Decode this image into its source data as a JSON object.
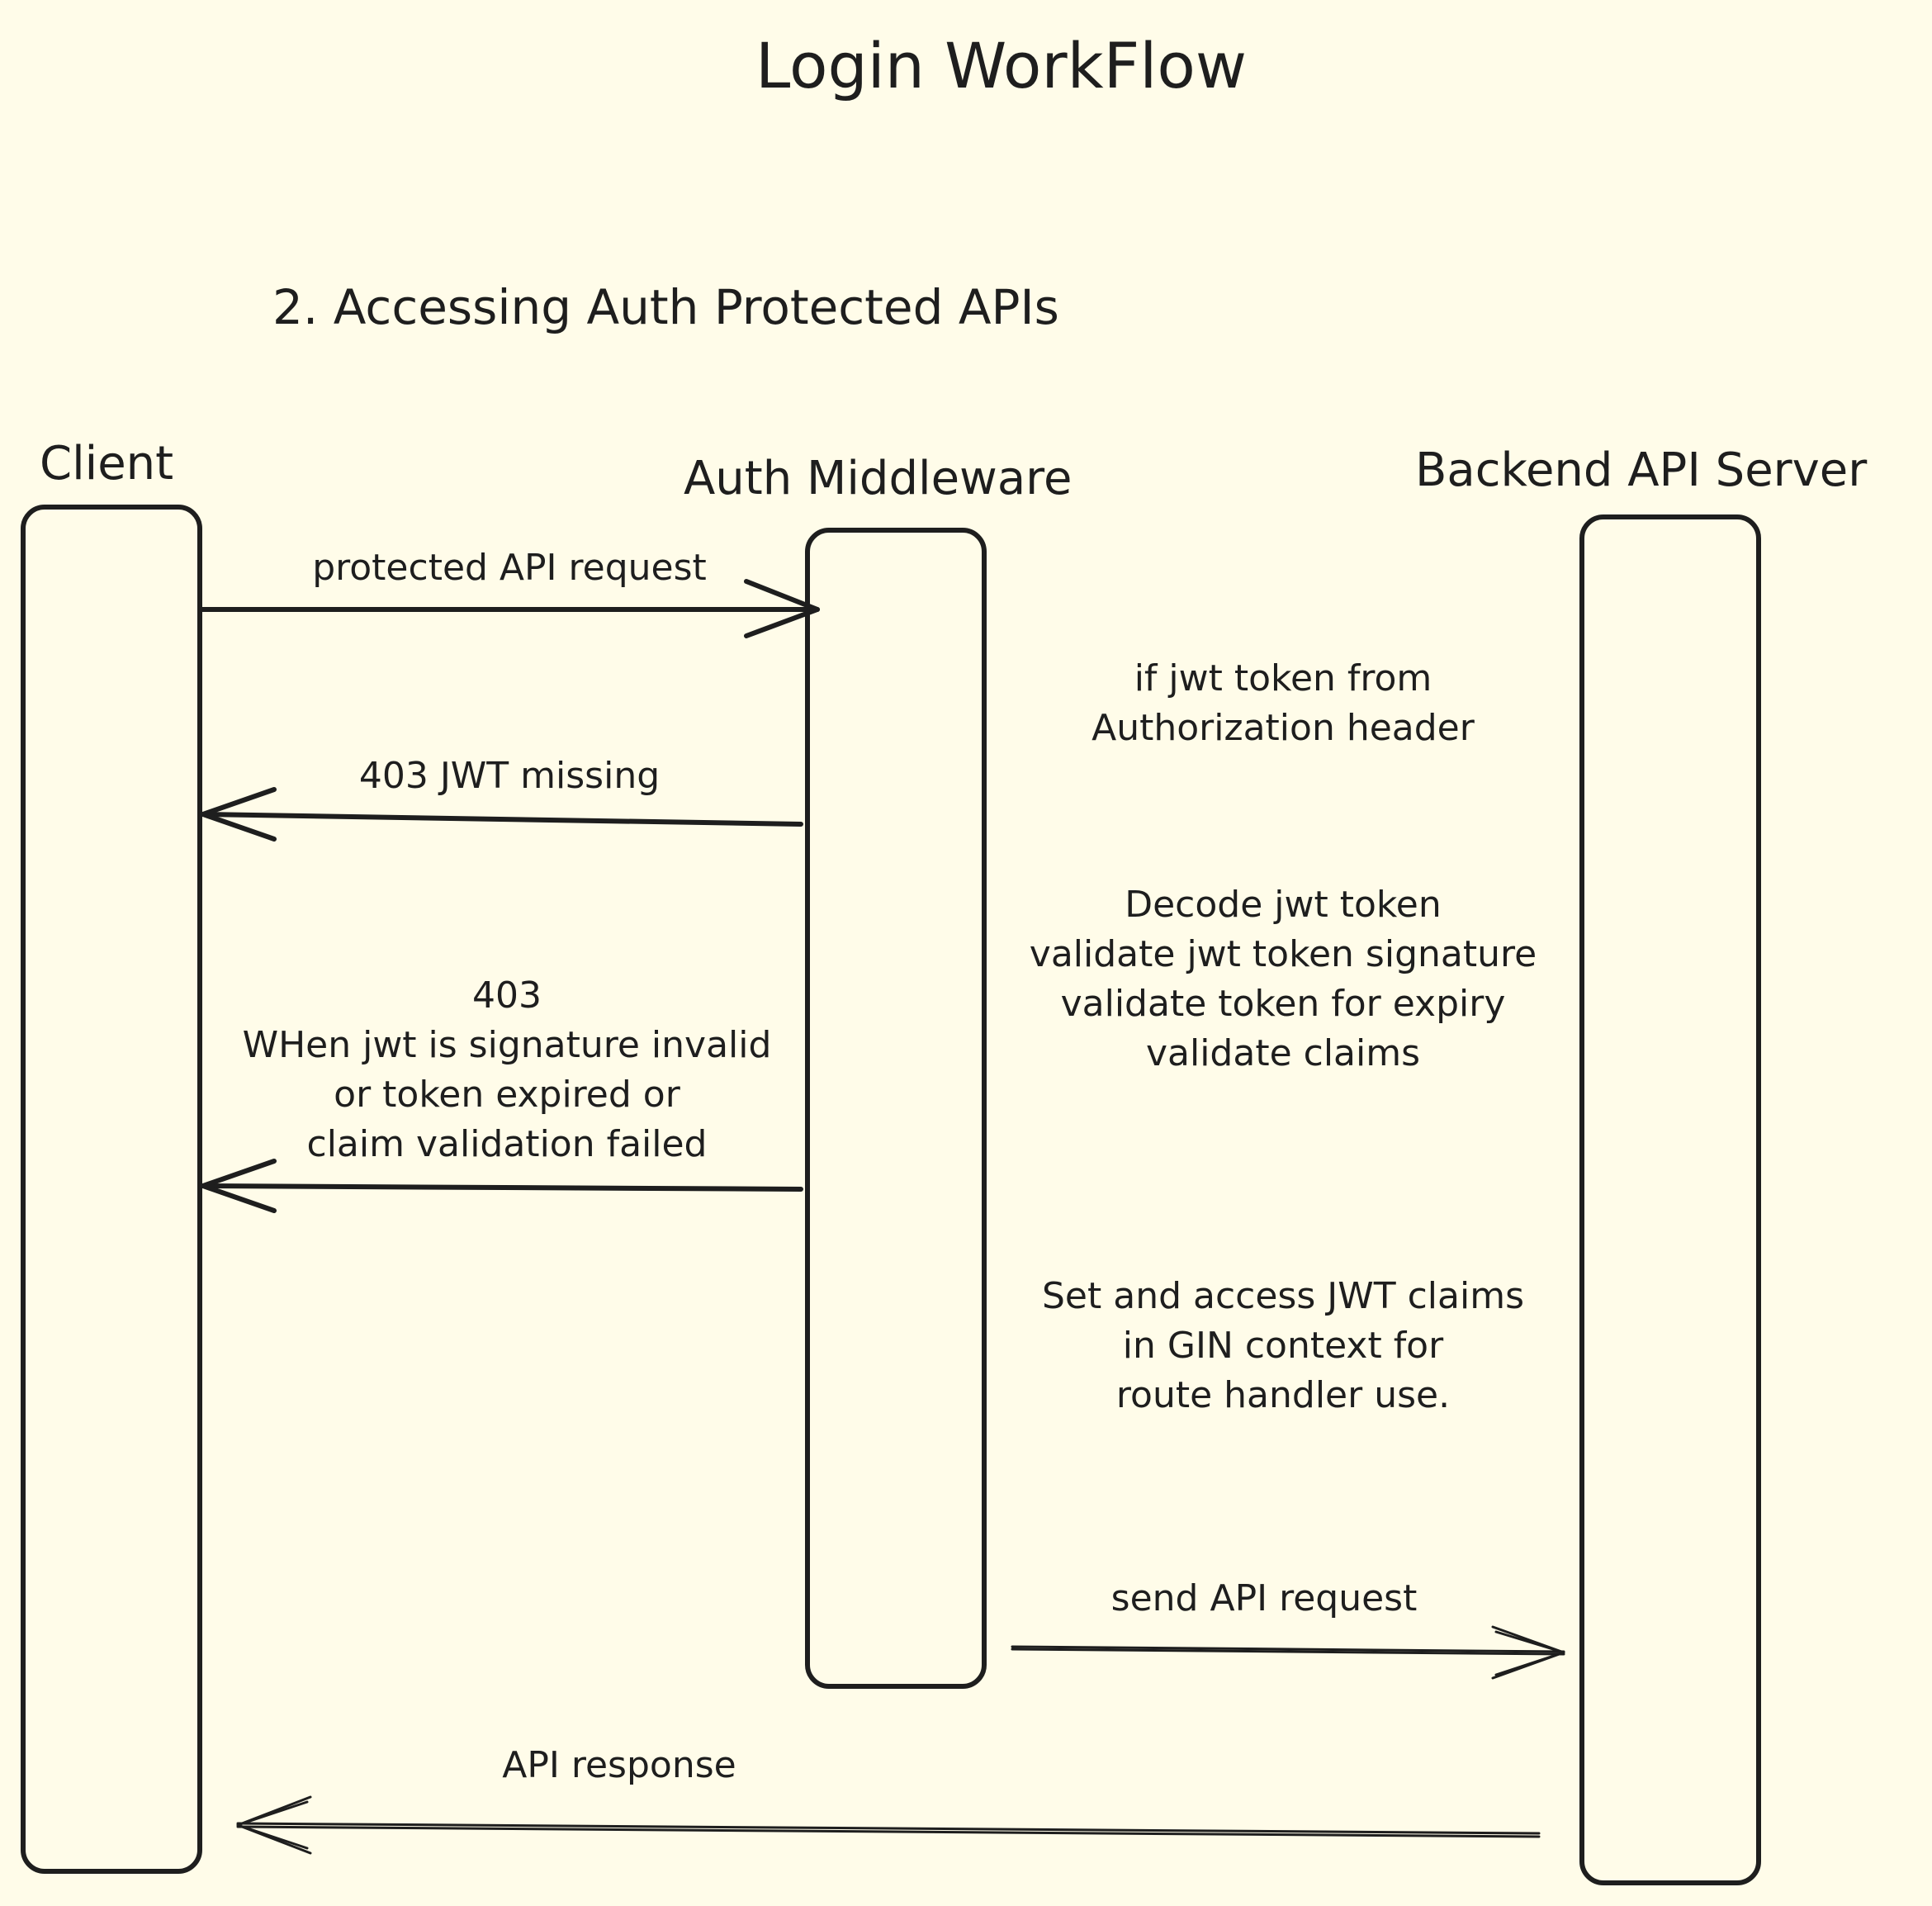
{
  "diagram": {
    "title": "Login WorkFlow",
    "subtitle": "2. Accessing Auth Protected APIs",
    "actors": {
      "client": "Client",
      "middleware": "Auth Middleware",
      "backend": "Backend API Server"
    },
    "messages": {
      "protected_request": "protected API request",
      "jwt_missing": "403 JWT missing",
      "invalid_403": "403\nWHen jwt is signature invalid\nor token expired or\nclaim validation failed",
      "send_request": "send API request",
      "api_response": "API response"
    },
    "notes": {
      "token_from_header": "if jwt token from\nAuthorization header",
      "decode_validate": "Decode jwt token\nvalidate jwt token signature\nvalidate token for expiry\nvalidate claims",
      "set_claims": "Set and access JWT claims\nin GIN context for\nroute handler use."
    }
  }
}
